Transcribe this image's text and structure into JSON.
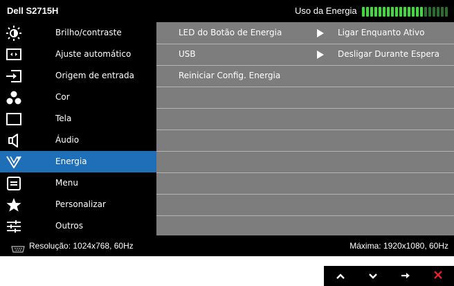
{
  "header": {
    "title": "Dell S2715H",
    "energy_label": "Uso da Energia",
    "energy_meter": {
      "total_bars": 21,
      "lit_bars": 15,
      "lit_color": "#3ddc3a",
      "dim_color": "#2a6e2a"
    }
  },
  "menu": {
    "items": [
      {
        "label": "Brilho/contraste",
        "icon": "brightness-icon"
      },
      {
        "label": "Ajuste automático",
        "icon": "auto-adjust-icon"
      },
      {
        "label": "Origem de entrada",
        "icon": "input-source-icon"
      },
      {
        "label": "Cor",
        "icon": "color-icon"
      },
      {
        "label": "Tela",
        "icon": "display-icon"
      },
      {
        "label": "Áudio",
        "icon": "speaker-icon"
      },
      {
        "label": "Energia",
        "icon": "energy-icon",
        "selected": true
      },
      {
        "label": "Menu",
        "icon": "menu-icon"
      },
      {
        "label": "Personalizar",
        "icon": "star-icon"
      },
      {
        "label": "Outros",
        "icon": "sliders-icon"
      }
    ]
  },
  "panel": {
    "rows": [
      {
        "label": "LED do Botão de Energia",
        "value": "Ligar Enquanto Ativo"
      },
      {
        "label": "USB",
        "value": "Desligar Durante Espera"
      },
      {
        "label": "Reiniciar Config. Energia",
        "value": ""
      }
    ]
  },
  "status": {
    "resolution": "Resolução: 1024x768, 60Hz",
    "max": "Máxima: 1920x1080, 60Hz"
  },
  "nav": {
    "buttons": [
      "up-button",
      "down-button",
      "right-button",
      "close-button"
    ]
  },
  "colors": {
    "selection": "#1f6fb8",
    "panel_bg": "#7d7d7d",
    "close": "#e0262a"
  }
}
